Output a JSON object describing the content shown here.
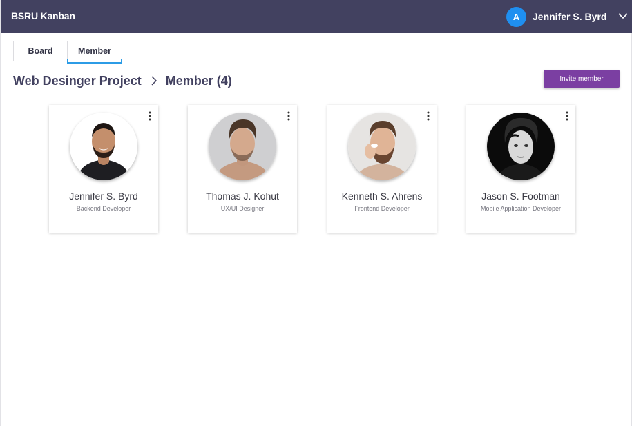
{
  "app": {
    "title": "BSRU Kanban"
  },
  "user": {
    "initial": "A",
    "name": "Jennifer S. Byrd"
  },
  "tabs": [
    {
      "label": "Board",
      "active": false
    },
    {
      "label": "Member",
      "active": true
    }
  ],
  "breadcrumb": {
    "project": "Web Desinger Project",
    "page": "Member (4)"
  },
  "actions": {
    "invite_label": "Invite member"
  },
  "members": [
    {
      "name": "Jennifer S. Byrd",
      "role": "Backend Developer"
    },
    {
      "name": "Thomas J. Kohut",
      "role": "UX/UI Designer"
    },
    {
      "name": "Kenneth S. Ahrens",
      "role": "Frontend Developer"
    },
    {
      "name": "Jason S. Footman",
      "role": "Mobile Application Developer"
    }
  ],
  "colors": {
    "topbar": "#424160",
    "avatar": "#1f8ff0",
    "accent_tab": "#2c9ce6",
    "invite_button": "#7b3fa2"
  }
}
